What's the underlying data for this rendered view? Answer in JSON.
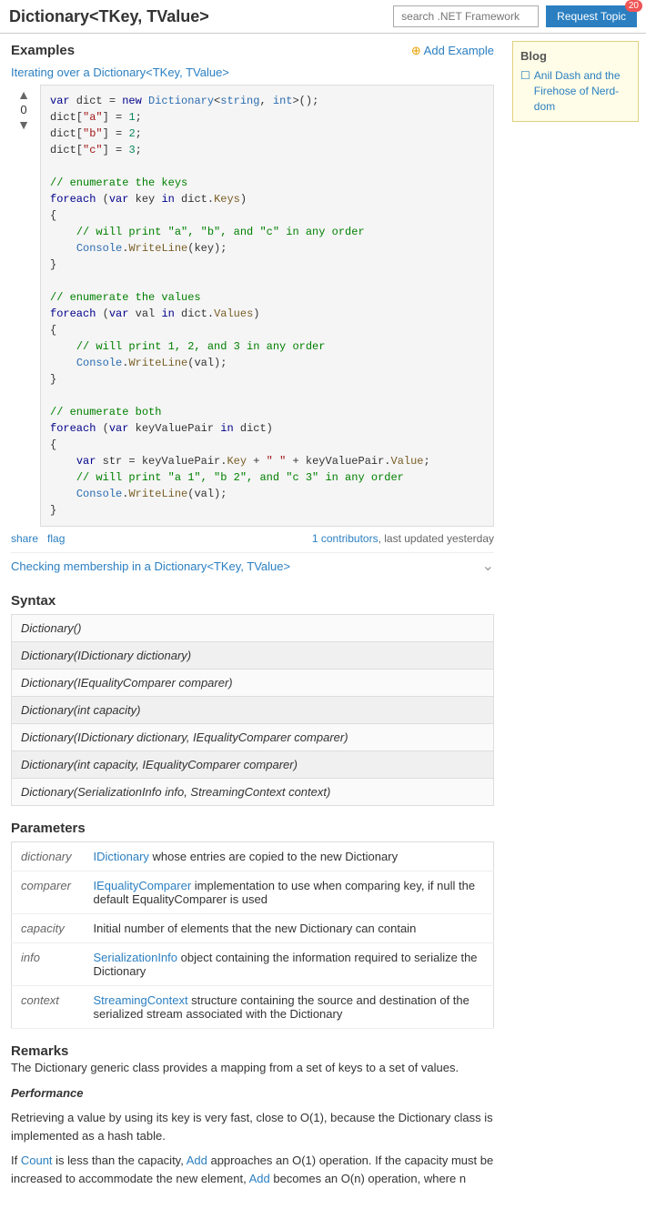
{
  "header": {
    "title": "Dictionary<TKey, TValue>",
    "search_placeholder": "search .NET Framework",
    "request_btn": "Request Topic",
    "badge": "20"
  },
  "examples_section": {
    "title": "Examples",
    "add_example": "Add Example",
    "examples": [
      {
        "id": 1,
        "title": "Iterating over a Dictionary<TKey, TValue>",
        "votes": 0,
        "contributors": "1 contributors",
        "updated": "last updated yesterday",
        "share": "share",
        "flag": "flag",
        "code_lines": [
          {
            "type": "code",
            "text": "var dict = new Dictionary<string, int>();"
          },
          {
            "type": "code",
            "text": "dict[\"a\"] = 1;"
          },
          {
            "type": "code",
            "text": "dict[\"b\"] = 2;"
          },
          {
            "type": "code",
            "text": "dict[\"c\"] = 3;"
          },
          {
            "type": "blank"
          },
          {
            "type": "comment",
            "text": "// enumerate the keys"
          },
          {
            "type": "code",
            "text": "foreach (var key in dict.Keys)"
          },
          {
            "type": "code",
            "text": "{"
          },
          {
            "type": "comment_indent",
            "text": "// will print \"a\", \"b\", and \"c\" in any order"
          },
          {
            "type": "code_indent",
            "text": "Console.WriteLine(key);"
          },
          {
            "type": "code",
            "text": "}"
          },
          {
            "type": "blank"
          },
          {
            "type": "comment",
            "text": "// enumerate the values"
          },
          {
            "type": "code",
            "text": "foreach (var val in dict.Values)"
          },
          {
            "type": "code",
            "text": "{"
          },
          {
            "type": "comment_indent",
            "text": "// will print 1, 2, and 3 in any order"
          },
          {
            "type": "code_indent",
            "text": "Console.WriteLine(val);"
          },
          {
            "type": "code",
            "text": "}"
          },
          {
            "type": "blank"
          },
          {
            "type": "comment",
            "text": "// enumerate both"
          },
          {
            "type": "code",
            "text": "foreach (var keyValuePair in dict)"
          },
          {
            "type": "code",
            "text": "{"
          },
          {
            "type": "code_indent",
            "text": "var str = keyValuePair.Key + \" \" + keyValuePair.Value;"
          },
          {
            "type": "comment_indent",
            "text": "// will print \"a 1\", \"b 2\", and \"c 3\" in any order"
          },
          {
            "type": "code_indent",
            "text": "Console.WriteLine(val);"
          },
          {
            "type": "code",
            "text": "}"
          }
        ]
      }
    ],
    "collapsed_example": {
      "title": "Checking membership in a Dictionary<TKey, TValue>"
    }
  },
  "syntax_section": {
    "title": "Syntax",
    "items": [
      "Dictionary()",
      "Dictionary(IDictionary dictionary)",
      "Dictionary(IEqualityComparer comparer)",
      "Dictionary(int capacity)",
      "Dictionary(IDictionary dictionary, IEqualityComparer comparer)",
      "Dictionary(int capacity, IEqualityComparer comparer)",
      "Dictionary(SerializationInfo info, StreamingContext context)"
    ]
  },
  "parameters_section": {
    "title": "Parameters",
    "rows": [
      {
        "name": "dictionary",
        "link": "IDictionary",
        "description": " whose entries are copied to the new Dictionary"
      },
      {
        "name": "comparer",
        "link": "IEqualityComparer",
        "description": " implementation to use when comparing key, if null the default EqualityComparer is used"
      },
      {
        "name": "capacity",
        "description": "Initial number of elements that the new Dictionary can contain"
      },
      {
        "name": "info",
        "link": "SerializationInfo",
        "description": " object containing the information required to serialize the Dictionary"
      },
      {
        "name": "context",
        "link": "StreamingContext",
        "description": " structure containing the source and destination of the serialized stream associated with the Dictionary"
      }
    ]
  },
  "remarks_section": {
    "title": "Remarks",
    "paragraphs": [
      "The Dictionary generic class provides a mapping from a set of keys to a set of values.",
      "Performance",
      "Retrieving a value by using its key is very fast, close to O(1), because the Dictionary class is implemented as a hash table.",
      "If Count is less than the capacity, Add approaches an O(1) operation. If the capacity must be increased to accommodate the new element, Add becomes an O(n) operation, where n"
    ],
    "count_link": "Count",
    "add_link1": "Add",
    "add_link2": "Add"
  },
  "sidebar": {
    "blog_title": "Blog",
    "blog_item": {
      "text": "Anil Dash and the Firehose of Nerd-dom",
      "url": "#"
    }
  }
}
